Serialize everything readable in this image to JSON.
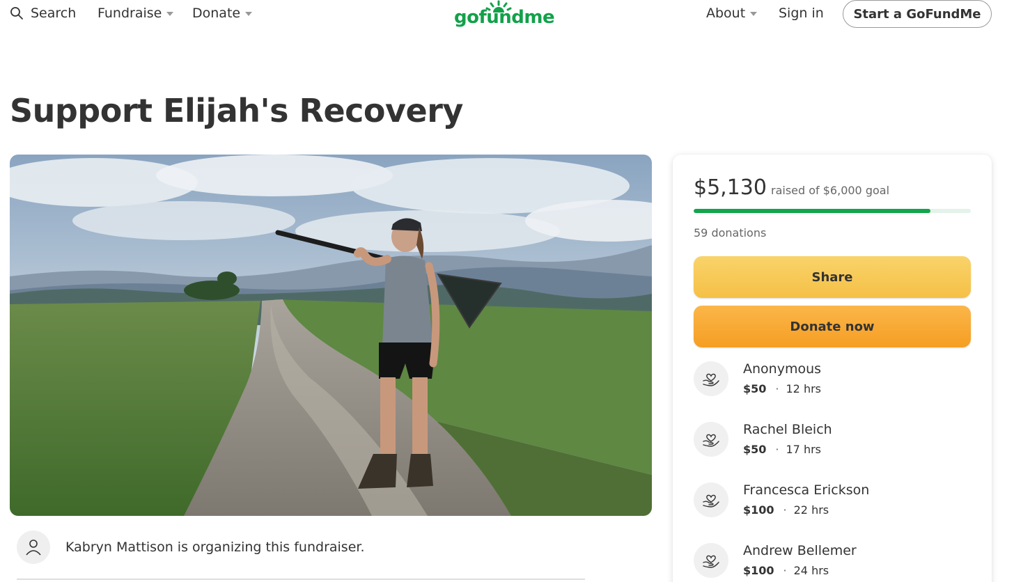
{
  "nav": {
    "search_label": "Search",
    "fundraise_label": "Fundraise",
    "donate_label": "Donate",
    "about_label": "About",
    "signin_label": "Sign in",
    "start_label": "Start a GoFundMe"
  },
  "brand": {
    "logo_text": "gofundme",
    "color": "#12a14a"
  },
  "campaign": {
    "title": "Support Elijah's Recovery",
    "organizer_text": "Kabryn Mattison is organizing this fundraiser."
  },
  "progress": {
    "raised": "$5,130",
    "goal_text": "raised of $6,000 goal",
    "fraction": 0.855,
    "donation_count": "59 donations",
    "fill_color": "#13a54d"
  },
  "actions": {
    "share_label": "Share",
    "donate_label": "Donate now"
  },
  "donations": [
    {
      "name": "Anonymous",
      "amount": "$50",
      "dot": "·",
      "time": "12 hrs",
      "icon": "heart-in-hand-icon"
    },
    {
      "name": "Rachel Bleich",
      "amount": "$50",
      "dot": "·",
      "time": "17 hrs",
      "icon": "heart-in-hand-icon"
    },
    {
      "name": "Francesca Erickson",
      "amount": "$100",
      "dot": "·",
      "time": "22 hrs",
      "icon": "heart-in-hand-icon"
    },
    {
      "name": "Andrew Bellemer",
      "amount": "$100",
      "dot": "·",
      "time": "24 hrs",
      "icon": "heart-in-hand-icon"
    }
  ]
}
